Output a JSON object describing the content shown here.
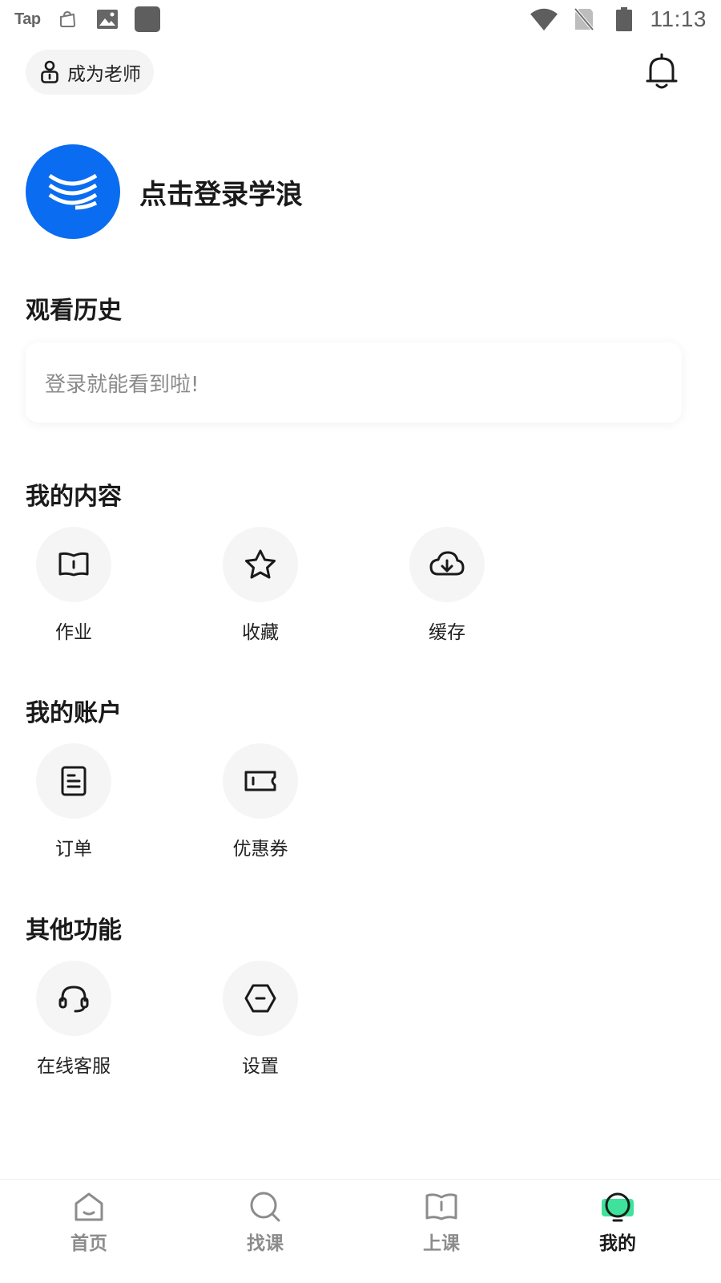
{
  "status_bar": {
    "app_label": "Tap",
    "time": "11:13"
  },
  "header": {
    "become_teacher_label": "成为老师"
  },
  "login": {
    "prompt": "点击登录学浪"
  },
  "history": {
    "title": "观看历史",
    "empty_text": "登录就能看到啦!"
  },
  "my_content": {
    "title": "我的内容",
    "items": [
      {
        "label": "作业",
        "icon": "book-icon"
      },
      {
        "label": "收藏",
        "icon": "star-icon"
      },
      {
        "label": "缓存",
        "icon": "cloud-download-icon"
      }
    ]
  },
  "my_account": {
    "title": "我的账户",
    "items": [
      {
        "label": "订单",
        "icon": "document-icon"
      },
      {
        "label": "优惠券",
        "icon": "ticket-icon"
      }
    ]
  },
  "other": {
    "title": "其他功能",
    "items": [
      {
        "label": "在线客服",
        "icon": "headset-icon"
      },
      {
        "label": "设置",
        "icon": "settings-hexagon-icon"
      }
    ]
  },
  "bottom_nav": {
    "items": [
      {
        "label": "首页",
        "icon": "home-icon",
        "active": false
      },
      {
        "label": "找课",
        "icon": "search-icon",
        "active": false
      },
      {
        "label": "上课",
        "icon": "book-open-icon",
        "active": false
      },
      {
        "label": "我的",
        "icon": "profile-icon",
        "active": true
      }
    ]
  },
  "colors": {
    "brand_blue": "#0a6cf0",
    "active_accent": "#3ee29a",
    "icon_circle_bg": "#f5f5f6"
  }
}
